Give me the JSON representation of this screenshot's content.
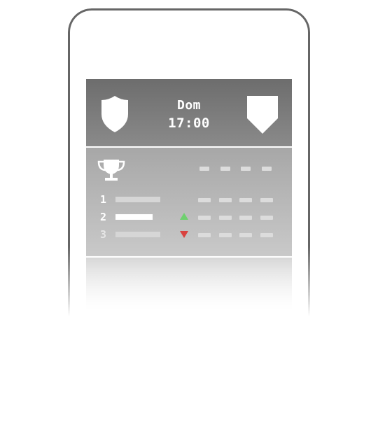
{
  "match": {
    "day": "Dom",
    "time": "17:00"
  },
  "standings": {
    "rows": [
      {
        "rank": "1"
      },
      {
        "rank": "2",
        "trend": "up"
      },
      {
        "rank": "3",
        "trend": "down"
      }
    ]
  },
  "colors": {
    "trend_up": "#6fd06f",
    "trend_down": "#d9423f",
    "header_bg": "#6d6d6d",
    "standings_bg": "#a7a7a7",
    "device_border": "#666666"
  },
  "icons": {
    "home_crest": "shield-icon",
    "away_crest": "pennant-shield-icon",
    "competition": "trophy-icon"
  }
}
